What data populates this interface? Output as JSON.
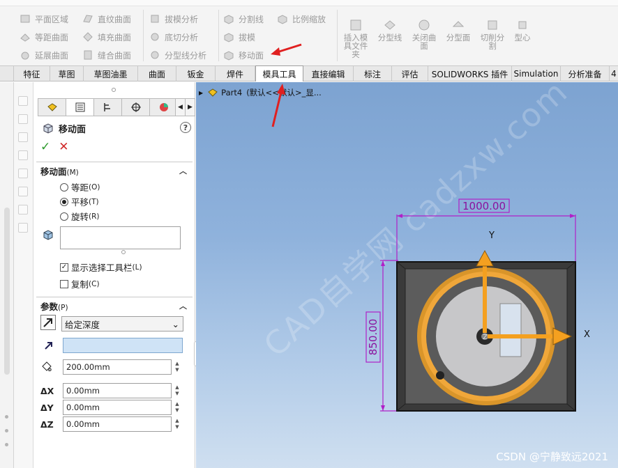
{
  "ribbon": {
    "group1": [
      "平面区域",
      "等距曲面",
      "延展曲面"
    ],
    "group2": [
      "直纹曲面",
      "填充曲面",
      "缝合曲面"
    ],
    "group3": [
      "拔模分析",
      "底切分析",
      "分型线分析"
    ],
    "group4": [
      "分割线",
      "拔模",
      "移动面"
    ],
    "group5": [
      "比例缩放"
    ],
    "big_buttons": [
      "插入模具文件夹",
      "分型线",
      "关闭曲面",
      "分型面",
      "切削分割",
      "型心"
    ],
    "icons": [
      "plane-region-icon",
      "offset-surface-icon",
      "extend-surface-icon",
      "ruled-surface-icon",
      "fill-surface-icon",
      "knit-surface-icon",
      "draft-analysis-icon",
      "undercut-analysis-icon",
      "parting-line-analysis-icon",
      "split-line-icon",
      "draft-icon",
      "move-face-icon",
      "scale-icon"
    ]
  },
  "tabs": [
    "特征",
    "草图",
    "草图油墨",
    "曲面",
    "钣金",
    "焊件",
    "模具工具",
    "直接编辑",
    "标注",
    "评估",
    "SOLIDWORKS 插件",
    "Simulation",
    "分析准备",
    "4"
  ],
  "active_tab": "模具工具",
  "property_manager": {
    "title": "移动面",
    "help": "?",
    "ok": "✓",
    "cancel": "✕",
    "section_move": {
      "label": "移动面",
      "shortcut": "(M)",
      "options": [
        {
          "label": "等距",
          "shortcut": "(O)",
          "selected": false
        },
        {
          "label": "平移",
          "shortcut": "(T)",
          "selected": true
        },
        {
          "label": "旋转",
          "shortcut": "(R)",
          "selected": false
        }
      ],
      "show_toolbar": {
        "label": "显示选择工具栏",
        "shortcut": "(L)",
        "checked": true
      },
      "copy": {
        "label": "复制",
        "shortcut": "(C)",
        "checked": false
      }
    },
    "section_params": {
      "label": "参数",
      "shortcut": "(P)",
      "end_condition": "给定深度",
      "distance": "200.00mm",
      "dx_label": "ΔX",
      "dx": "0.00mm",
      "dy_label": "ΔY",
      "dy": "0.00mm",
      "dz_label": "ΔZ",
      "dz": "0.00mm"
    }
  },
  "viewport": {
    "tree_label": "Part4",
    "tree_config": "(默认<<默认>_显...",
    "dim_width": "1000.00",
    "dim_height": "850.00",
    "axis_x": "X",
    "axis_y": "Y",
    "origin_label": "Z",
    "watermark": "CAD自学网 cadzxw.com",
    "credit": "CSDN @宁静致远2021",
    "colors": {
      "dimension": "#b020c8",
      "handle": "#ee9a22",
      "annotation_arrow": "#e02020"
    }
  }
}
